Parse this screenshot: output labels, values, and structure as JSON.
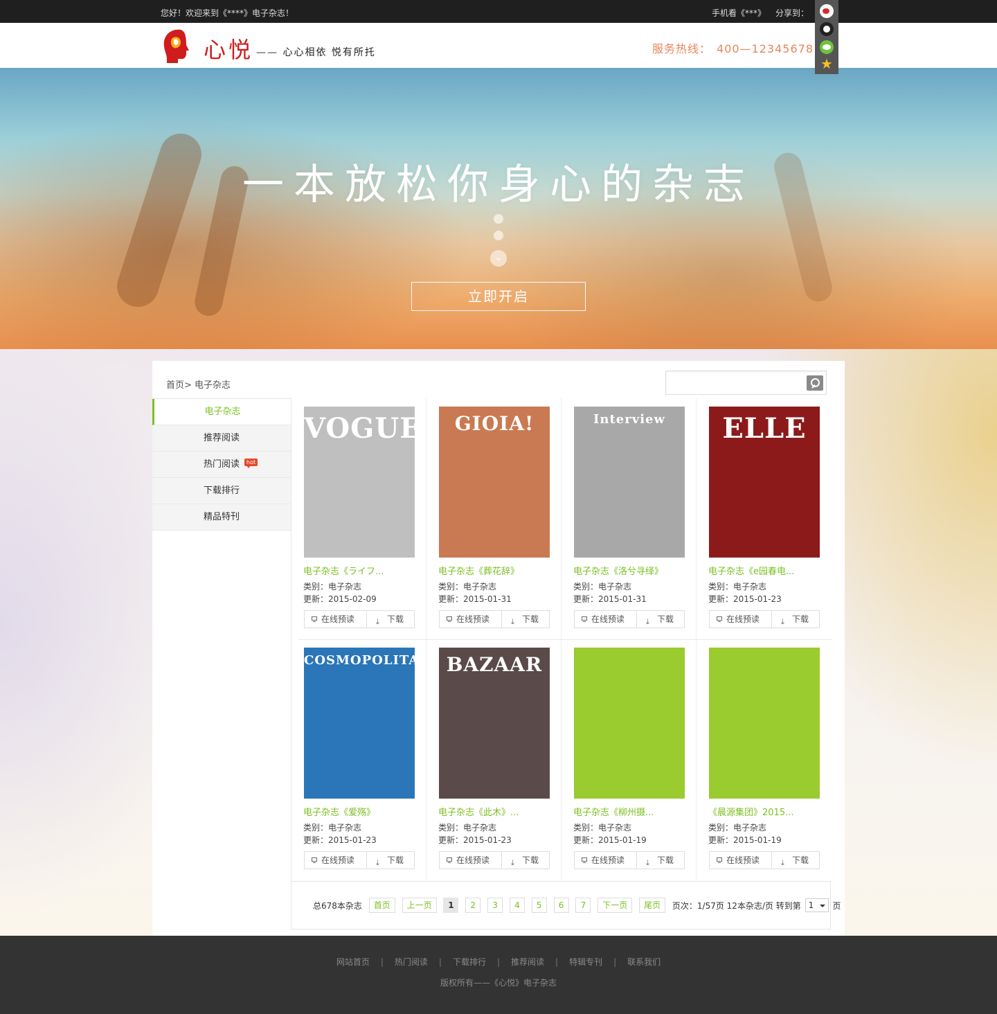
{
  "topbar": {
    "welcome": "您好！欢迎来到《****》电子杂志！",
    "mobile": "手机看《***》",
    "share_label": "分享到："
  },
  "share_icons": [
    "weibo-icon",
    "qq-icon",
    "wechat-icon",
    "star-icon"
  ],
  "header": {
    "logo_name": "心悦",
    "slogan": "—— 心心相依  悦有所托",
    "hotline_label": "服务热线：",
    "hotline_number": "400—12345678"
  },
  "banner": {
    "title": "一本放松你身心的杂志",
    "button": "立即开启"
  },
  "breadcrumb": "首页> 电子杂志",
  "search": {
    "placeholder": ""
  },
  "sidebar": {
    "items": [
      {
        "label": "电子杂志",
        "active": true
      },
      {
        "label": "推荐阅读"
      },
      {
        "label": "热门阅读",
        "badge": "hot"
      },
      {
        "label": "下载排行"
      },
      {
        "label": "精品特刊"
      }
    ]
  },
  "card_labels": {
    "category_prefix": "类别：",
    "update_prefix": "更新：",
    "preview": "在线预读",
    "download": "下载"
  },
  "magazines": [
    {
      "title": "电子杂志《ライフ...",
      "category": "电子杂志",
      "date": "2015-02-09",
      "cover_text": "VOGUE",
      "cover_bg": "#bfbfbf"
    },
    {
      "title": "电子杂志《葬花辞》",
      "category": "电子杂志",
      "date": "2015-01-31",
      "cover_text": "GIOIA!",
      "cover_bg": "#c97a52"
    },
    {
      "title": "电子杂志《洛兮寻绎》",
      "category": "电子杂志",
      "date": "2015-01-31",
      "cover_text": "Interview",
      "cover_bg": "#a8a8a8"
    },
    {
      "title": "电子杂志《e园春电...",
      "category": "电子杂志",
      "date": "2015-01-23",
      "cover_text": "ELLE",
      "cover_bg": "#8c1a1a"
    },
    {
      "title": "电子杂志《爱殇》",
      "category": "电子杂志",
      "date": "2015-01-23",
      "cover_text": "COSMOPOLITAN",
      "cover_bg": "#2a76b8"
    },
    {
      "title": "电子杂志《此木》...",
      "category": "电子杂志",
      "date": "2015-01-23",
      "cover_text": "BAZAAR",
      "cover_bg": "#5a4a4a"
    },
    {
      "title": "电子杂志《柳州摄...",
      "category": "电子杂志",
      "date": "2015-01-19",
      "cover_text": "",
      "cover_bg": "#9acb2f"
    },
    {
      "title": "《晨源集团》2015...",
      "category": "电子杂志",
      "date": "2015-01-19",
      "cover_text": "",
      "cover_bg": "#9acb2f"
    }
  ],
  "pagination": {
    "total": "总678本杂志",
    "first": "首页",
    "prev": "上一页",
    "pages": [
      "1",
      "2",
      "3",
      "4",
      "5",
      "6",
      "7"
    ],
    "current": "1",
    "next": "下一页",
    "last": "尾页",
    "info": "页次：1/57页 12本杂志/页 转到第",
    "goto_value": "1",
    "goto_suffix": "页"
  },
  "footer": {
    "links": [
      "网站首页",
      "热门阅读",
      "下载排行",
      "推荐阅读",
      "特辑专刊",
      "联系我们"
    ],
    "separator": "|",
    "copyright": "版权所有——《心悦》电子杂志"
  },
  "colors": {
    "accent": "#7cc022",
    "topbar": "#1f1f1f",
    "footer": "#333333",
    "hotline": "#e8845c",
    "logo": "#d01c1c"
  }
}
